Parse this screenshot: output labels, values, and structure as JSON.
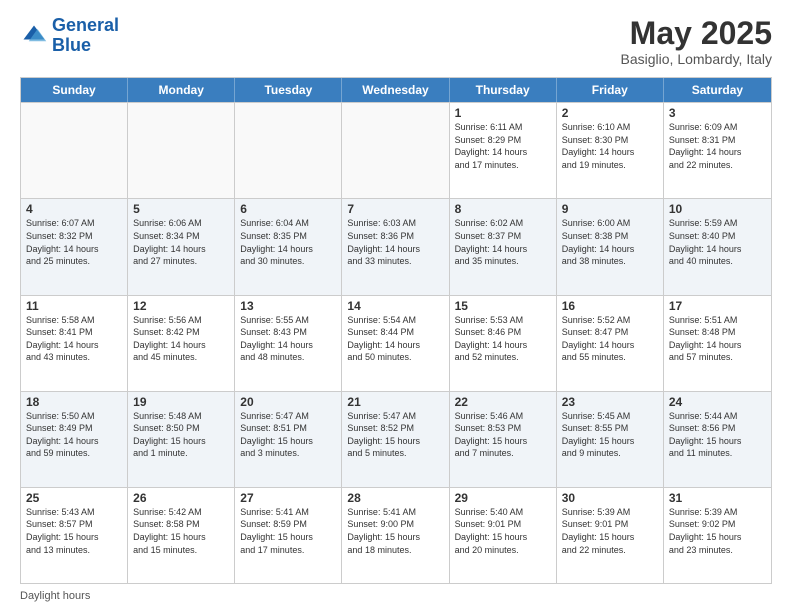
{
  "header": {
    "logo_line1": "General",
    "logo_line2": "Blue",
    "month": "May 2025",
    "location": "Basiglio, Lombardy, Italy"
  },
  "days_of_week": [
    "Sunday",
    "Monday",
    "Tuesday",
    "Wednesday",
    "Thursday",
    "Friday",
    "Saturday"
  ],
  "footer": "Daylight hours",
  "weeks": [
    [
      {
        "day": "",
        "info": "",
        "empty": true
      },
      {
        "day": "",
        "info": "",
        "empty": true
      },
      {
        "day": "",
        "info": "",
        "empty": true
      },
      {
        "day": "",
        "info": "",
        "empty": true
      },
      {
        "day": "1",
        "info": "Sunrise: 6:11 AM\nSunset: 8:29 PM\nDaylight: 14 hours\nand 17 minutes.",
        "empty": false
      },
      {
        "day": "2",
        "info": "Sunrise: 6:10 AM\nSunset: 8:30 PM\nDaylight: 14 hours\nand 19 minutes.",
        "empty": false
      },
      {
        "day": "3",
        "info": "Sunrise: 6:09 AM\nSunset: 8:31 PM\nDaylight: 14 hours\nand 22 minutes.",
        "empty": false
      }
    ],
    [
      {
        "day": "4",
        "info": "Sunrise: 6:07 AM\nSunset: 8:32 PM\nDaylight: 14 hours\nand 25 minutes.",
        "empty": false
      },
      {
        "day": "5",
        "info": "Sunrise: 6:06 AM\nSunset: 8:34 PM\nDaylight: 14 hours\nand 27 minutes.",
        "empty": false
      },
      {
        "day": "6",
        "info": "Sunrise: 6:04 AM\nSunset: 8:35 PM\nDaylight: 14 hours\nand 30 minutes.",
        "empty": false
      },
      {
        "day": "7",
        "info": "Sunrise: 6:03 AM\nSunset: 8:36 PM\nDaylight: 14 hours\nand 33 minutes.",
        "empty": false
      },
      {
        "day": "8",
        "info": "Sunrise: 6:02 AM\nSunset: 8:37 PM\nDaylight: 14 hours\nand 35 minutes.",
        "empty": false
      },
      {
        "day": "9",
        "info": "Sunrise: 6:00 AM\nSunset: 8:38 PM\nDaylight: 14 hours\nand 38 minutes.",
        "empty": false
      },
      {
        "day": "10",
        "info": "Sunrise: 5:59 AM\nSunset: 8:40 PM\nDaylight: 14 hours\nand 40 minutes.",
        "empty": false
      }
    ],
    [
      {
        "day": "11",
        "info": "Sunrise: 5:58 AM\nSunset: 8:41 PM\nDaylight: 14 hours\nand 43 minutes.",
        "empty": false
      },
      {
        "day": "12",
        "info": "Sunrise: 5:56 AM\nSunset: 8:42 PM\nDaylight: 14 hours\nand 45 minutes.",
        "empty": false
      },
      {
        "day": "13",
        "info": "Sunrise: 5:55 AM\nSunset: 8:43 PM\nDaylight: 14 hours\nand 48 minutes.",
        "empty": false
      },
      {
        "day": "14",
        "info": "Sunrise: 5:54 AM\nSunset: 8:44 PM\nDaylight: 14 hours\nand 50 minutes.",
        "empty": false
      },
      {
        "day": "15",
        "info": "Sunrise: 5:53 AM\nSunset: 8:46 PM\nDaylight: 14 hours\nand 52 minutes.",
        "empty": false
      },
      {
        "day": "16",
        "info": "Sunrise: 5:52 AM\nSunset: 8:47 PM\nDaylight: 14 hours\nand 55 minutes.",
        "empty": false
      },
      {
        "day": "17",
        "info": "Sunrise: 5:51 AM\nSunset: 8:48 PM\nDaylight: 14 hours\nand 57 minutes.",
        "empty": false
      }
    ],
    [
      {
        "day": "18",
        "info": "Sunrise: 5:50 AM\nSunset: 8:49 PM\nDaylight: 14 hours\nand 59 minutes.",
        "empty": false
      },
      {
        "day": "19",
        "info": "Sunrise: 5:48 AM\nSunset: 8:50 PM\nDaylight: 15 hours\nand 1 minute.",
        "empty": false
      },
      {
        "day": "20",
        "info": "Sunrise: 5:47 AM\nSunset: 8:51 PM\nDaylight: 15 hours\nand 3 minutes.",
        "empty": false
      },
      {
        "day": "21",
        "info": "Sunrise: 5:47 AM\nSunset: 8:52 PM\nDaylight: 15 hours\nand 5 minutes.",
        "empty": false
      },
      {
        "day": "22",
        "info": "Sunrise: 5:46 AM\nSunset: 8:53 PM\nDaylight: 15 hours\nand 7 minutes.",
        "empty": false
      },
      {
        "day": "23",
        "info": "Sunrise: 5:45 AM\nSunset: 8:55 PM\nDaylight: 15 hours\nand 9 minutes.",
        "empty": false
      },
      {
        "day": "24",
        "info": "Sunrise: 5:44 AM\nSunset: 8:56 PM\nDaylight: 15 hours\nand 11 minutes.",
        "empty": false
      }
    ],
    [
      {
        "day": "25",
        "info": "Sunrise: 5:43 AM\nSunset: 8:57 PM\nDaylight: 15 hours\nand 13 minutes.",
        "empty": false
      },
      {
        "day": "26",
        "info": "Sunrise: 5:42 AM\nSunset: 8:58 PM\nDaylight: 15 hours\nand 15 minutes.",
        "empty": false
      },
      {
        "day": "27",
        "info": "Sunrise: 5:41 AM\nSunset: 8:59 PM\nDaylight: 15 hours\nand 17 minutes.",
        "empty": false
      },
      {
        "day": "28",
        "info": "Sunrise: 5:41 AM\nSunset: 9:00 PM\nDaylight: 15 hours\nand 18 minutes.",
        "empty": false
      },
      {
        "day": "29",
        "info": "Sunrise: 5:40 AM\nSunset: 9:01 PM\nDaylight: 15 hours\nand 20 minutes.",
        "empty": false
      },
      {
        "day": "30",
        "info": "Sunrise: 5:39 AM\nSunset: 9:01 PM\nDaylight: 15 hours\nand 22 minutes.",
        "empty": false
      },
      {
        "day": "31",
        "info": "Sunrise: 5:39 AM\nSunset: 9:02 PM\nDaylight: 15 hours\nand 23 minutes.",
        "empty": false
      }
    ]
  ]
}
